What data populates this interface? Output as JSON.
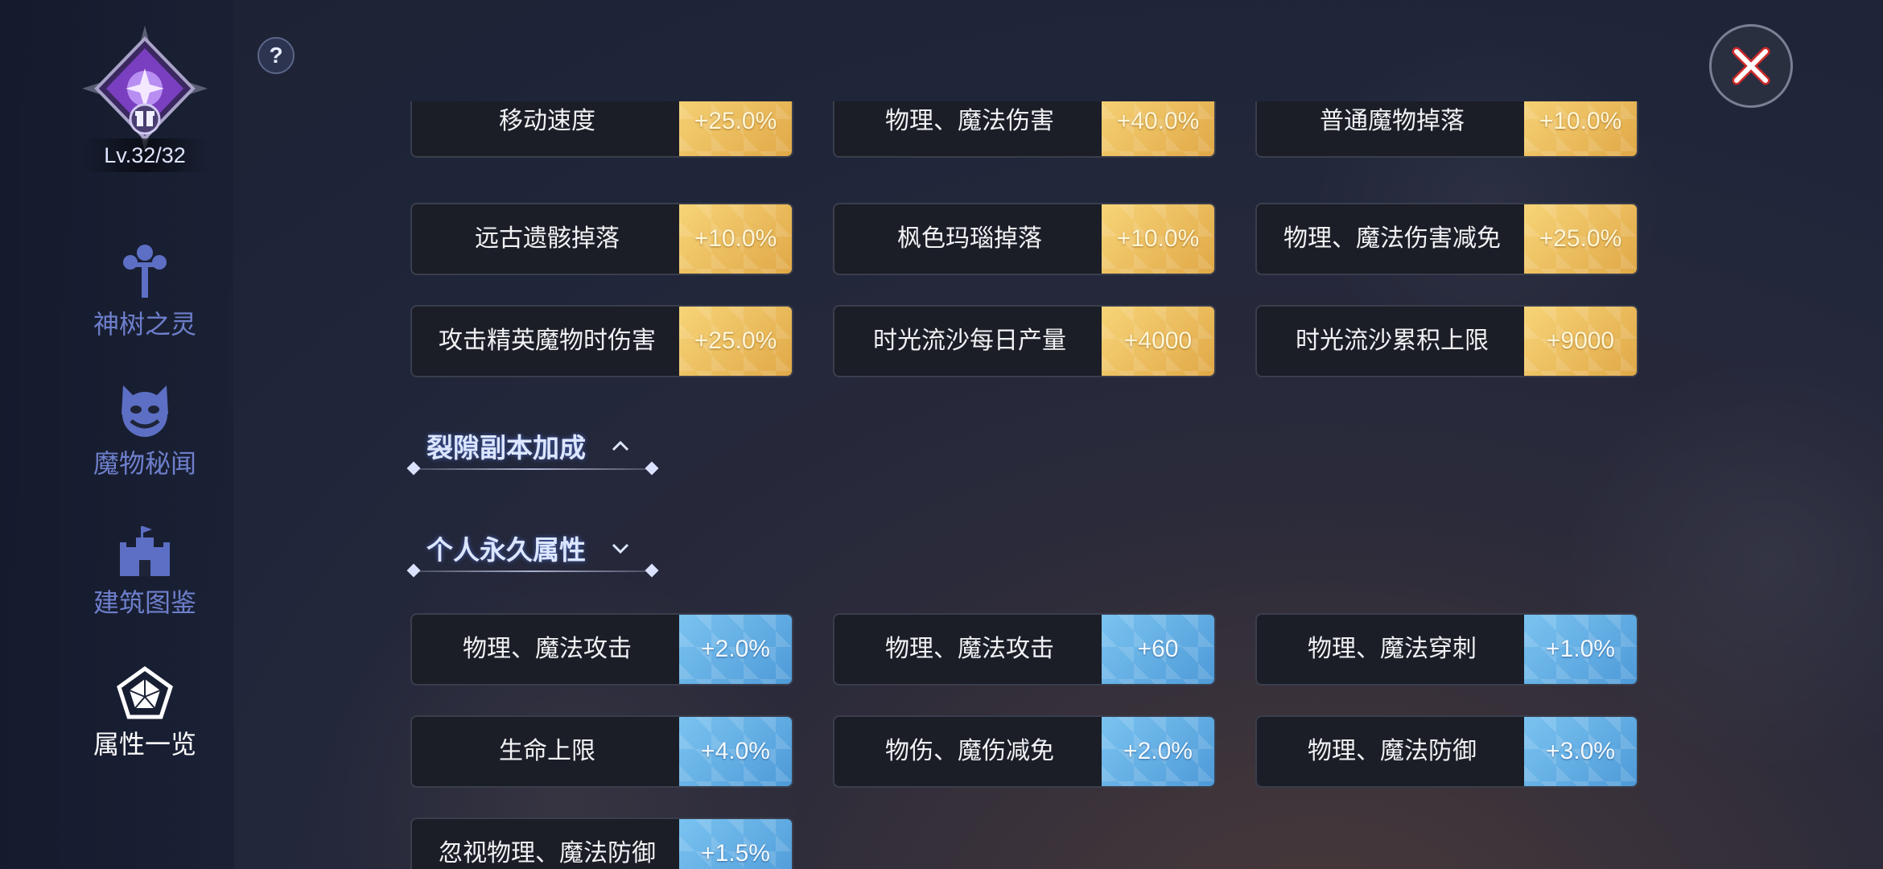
{
  "sidebar": {
    "level": "Lv.32/32",
    "items": [
      {
        "label": "神树之灵",
        "icon": "tree-icon"
      },
      {
        "label": "魔物秘闻",
        "icon": "monster-icon"
      },
      {
        "label": "建筑图鉴",
        "icon": "castle-icon"
      },
      {
        "label": "属性一览",
        "icon": "pentagon-icon"
      }
    ]
  },
  "help": {
    "label": "?"
  },
  "gold_cards": [
    {
      "name": "移动速度",
      "value": "+25.0%"
    },
    {
      "name": "物理、魔法伤害",
      "value": "+40.0%"
    },
    {
      "name": "普通魔物掉落",
      "value": "+10.0%"
    },
    {
      "name": "远古遗骸掉落",
      "value": "+10.0%"
    },
    {
      "name": "枫色玛瑙掉落",
      "value": "+10.0%"
    },
    {
      "name": "物理、魔法伤害减免",
      "value": "+25.0%"
    },
    {
      "name": "攻击精英魔物时伤害",
      "value": "+25.0%"
    },
    {
      "name": "时光流沙每日产量",
      "value": "+4000"
    },
    {
      "name": "时光流沙累积上限",
      "value": "+9000"
    }
  ],
  "sections": {
    "rift": {
      "title": "裂隙副本加成"
    },
    "personal": {
      "title": "个人永久属性"
    }
  },
  "blue_cards": [
    {
      "name": "物理、魔法攻击",
      "value": "+2.0%"
    },
    {
      "name": "物理、魔法攻击",
      "value": "+60"
    },
    {
      "name": "物理、魔法穿刺",
      "value": "+1.0%"
    },
    {
      "name": "生命上限",
      "value": "+4.0%"
    },
    {
      "name": "物伤、魔伤减免",
      "value": "+2.0%"
    },
    {
      "name": "物理、魔法防御",
      "value": "+3.0%"
    },
    {
      "name": "忽视物理、魔法防御",
      "value": "+1.5%"
    }
  ],
  "colors": {
    "gold": "#f0c160",
    "blue": "#62aee4",
    "nav_inactive": "#6e7fcc"
  }
}
